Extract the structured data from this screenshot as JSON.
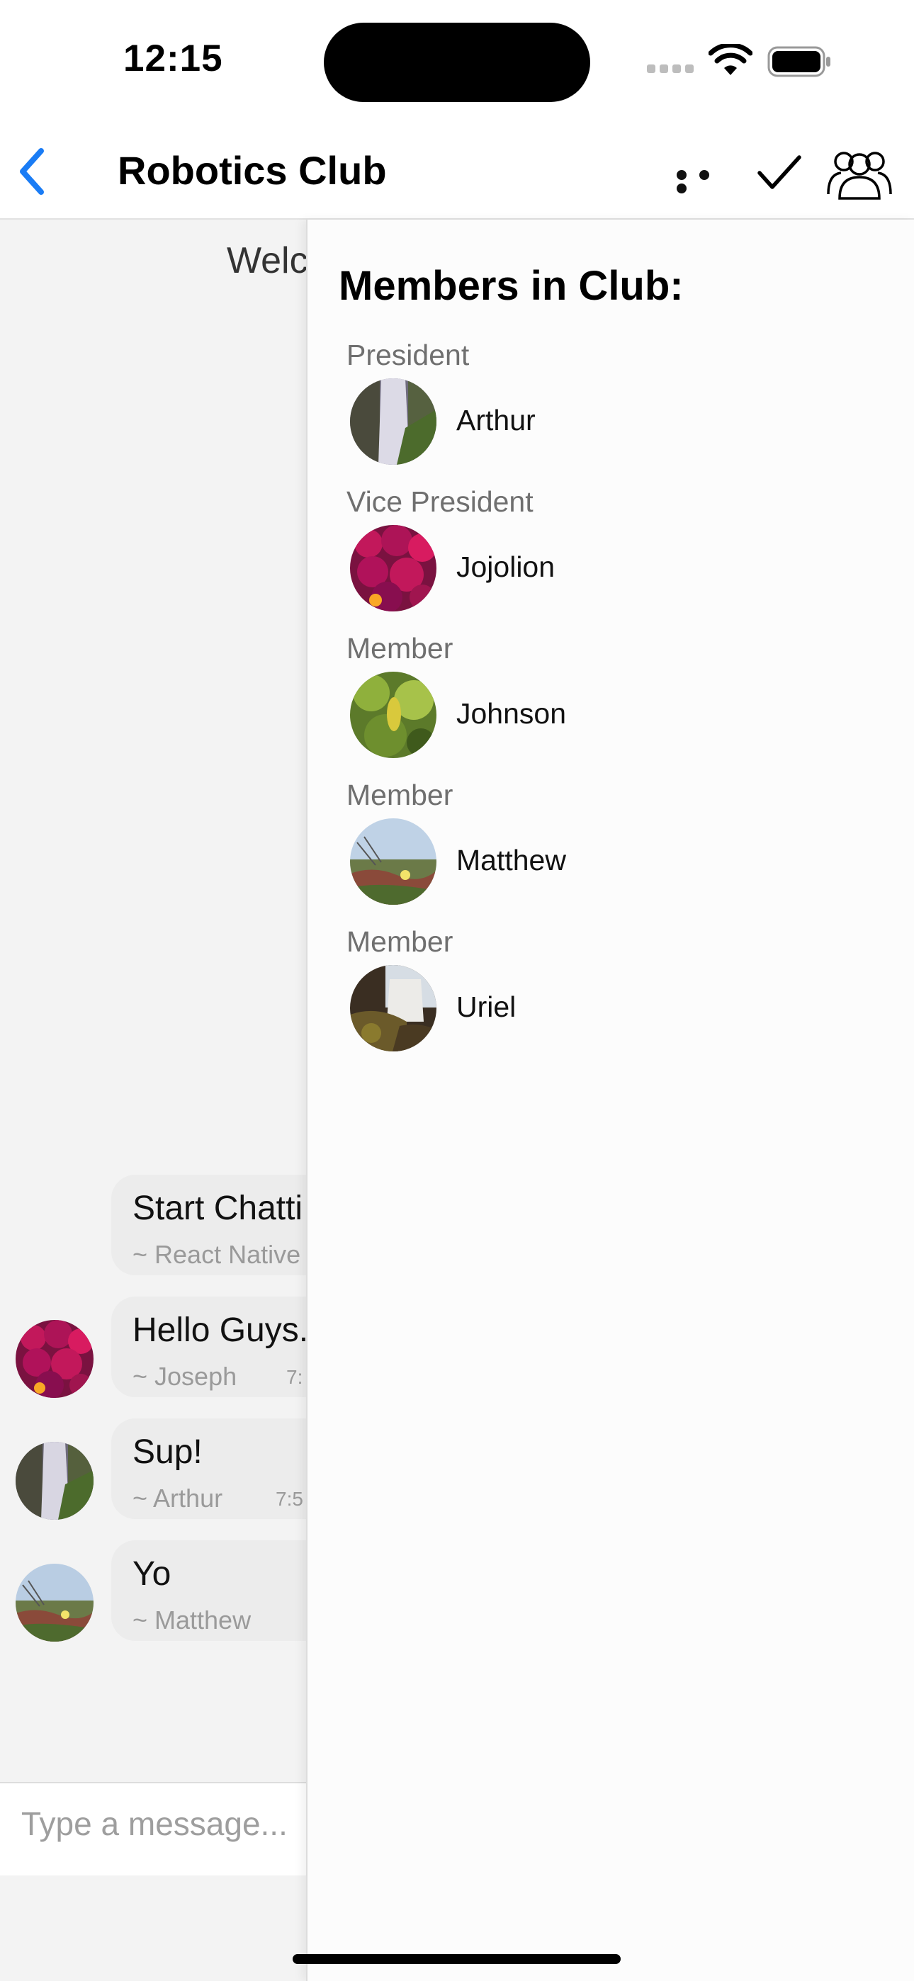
{
  "status_bar": {
    "time": "12:15"
  },
  "header": {
    "title": "Robotics Club"
  },
  "chat": {
    "welcome_text": "Welc",
    "messages": [
      {
        "text": "Start Chatti",
        "sender": "~ React Native",
        "time": ""
      },
      {
        "text": "Hello Guys.",
        "sender": "~ Joseph",
        "time": "7:"
      },
      {
        "text": "Sup!",
        "sender": "~ Arthur",
        "time": "7:5"
      },
      {
        "text": "Yo",
        "sender": "~ Matthew",
        "time": ""
      }
    ],
    "composer_placeholder": "Type a message..."
  },
  "drawer": {
    "title": "Members in Club:",
    "members": [
      {
        "role": "President",
        "name": "Arthur"
      },
      {
        "role": "Vice President",
        "name": "Jojolion"
      },
      {
        "role": "Member",
        "name": "Johnson"
      },
      {
        "role": "Member",
        "name": "Matthew"
      },
      {
        "role": "Member",
        "name": "Uriel"
      }
    ]
  },
  "colors": {
    "accent": "#1a7cf5",
    "chat_background": "#f3f3f3",
    "bubble": "#ececec",
    "drawer_background": "#fcfcfc"
  }
}
